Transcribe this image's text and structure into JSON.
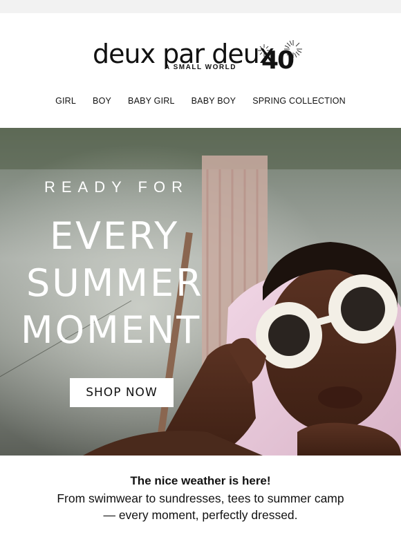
{
  "brand": {
    "wordmark": "deux par deux",
    "tagline": "A SMALL WORLD",
    "anniversary": "40"
  },
  "nav": {
    "items": [
      "GIRL",
      "BOY",
      "BABY GIRL",
      "BABY BOY",
      "SPRING COLLECTION"
    ]
  },
  "hero": {
    "kicker": "READY FOR",
    "line1": "EVERY",
    "line2": "SUMMER",
    "line3": "MOMENT",
    "cta": "SHOP NOW"
  },
  "copy": {
    "headline": "The nice weather is here!",
    "line1": "From swimwear to sundresses, tees to summer camp",
    "line2": "— every moment, perfectly dressed."
  },
  "colors": {
    "background": "#f2f2f2",
    "panel": "#ffffff",
    "text": "#111111",
    "hero_text": "#ffffff"
  }
}
